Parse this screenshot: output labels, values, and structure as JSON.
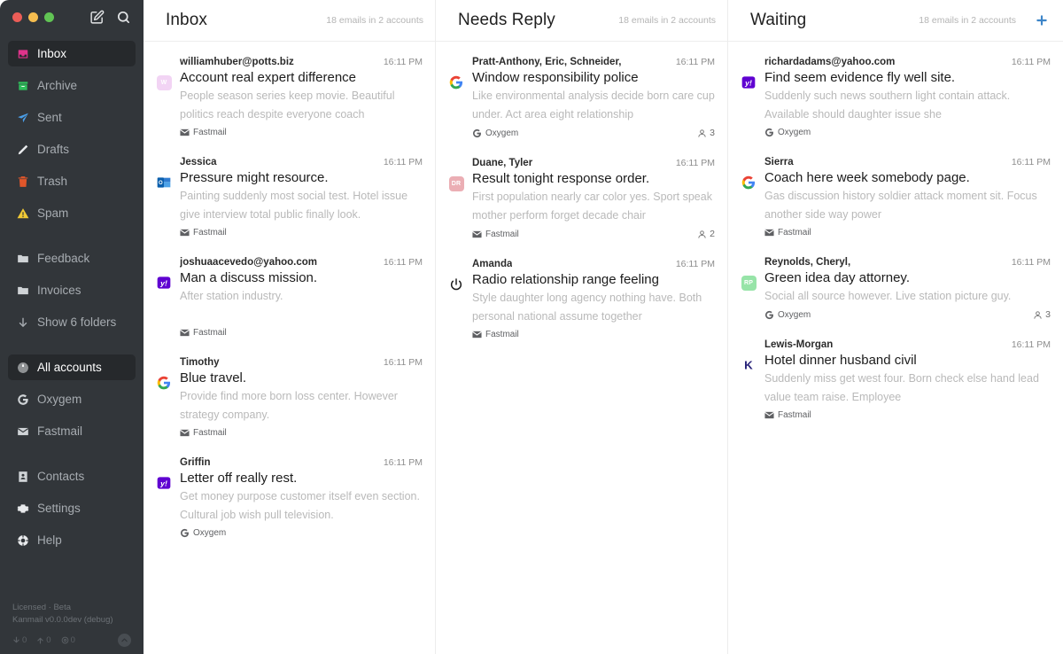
{
  "window": {
    "traffic_lights": [
      "close",
      "minimize",
      "maximize"
    ],
    "compose_icon": "compose-icon",
    "search_icon": "search-icon"
  },
  "sidebar": {
    "folders": [
      {
        "label": "Inbox",
        "icon": "inbox-icon",
        "active": true
      },
      {
        "label": "Archive",
        "icon": "archive-icon",
        "active": false
      },
      {
        "label": "Sent",
        "icon": "sent-icon",
        "active": false
      },
      {
        "label": "Drafts",
        "icon": "drafts-icon",
        "active": false
      },
      {
        "label": "Trash",
        "icon": "trash-icon",
        "active": false
      },
      {
        "label": "Spam",
        "icon": "spam-icon",
        "active": false
      }
    ],
    "custom_folders": [
      {
        "label": "Feedback",
        "icon": "folder-icon"
      },
      {
        "label": "Invoices",
        "icon": "folder-icon"
      }
    ],
    "show_more": {
      "label": "Show 6 folders",
      "icon": "arrow-down-icon"
    },
    "accounts": [
      {
        "label": "All accounts",
        "icon": "globe-icon",
        "active": true
      },
      {
        "label": "Oxygem",
        "icon": "google-icon",
        "active": false
      },
      {
        "label": "Fastmail",
        "icon": "envelope-icon",
        "active": false
      }
    ],
    "app_links": [
      {
        "label": "Contacts",
        "icon": "contacts-icon"
      },
      {
        "label": "Settings",
        "icon": "gear-icon"
      },
      {
        "label": "Help",
        "icon": "help-icon"
      }
    ],
    "footer": {
      "license": "Licensed · Beta",
      "version": "Kanmail v0.0.0dev (debug)",
      "counters": [
        {
          "icon": "download-icon",
          "value": "0"
        },
        {
          "icon": "upload-icon",
          "value": "0"
        },
        {
          "icon": "eye-icon",
          "value": "0"
        }
      ],
      "collapse_icon": "chevron-up-icon"
    }
  },
  "add_column_button": {
    "icon": "plus-icon",
    "color": "#3d85c8"
  },
  "columns": [
    {
      "title": "Inbox",
      "meta": "18 emails in 2 accounts",
      "emails": [
        {
          "from": "williamhuber@potts.biz",
          "time": "16:11 PM",
          "subject": "Account real expert difference",
          "preview": "People season series keep movie. Beautiful politics reach despite everyone coach",
          "account": "Fastmail",
          "account_icon": "envelope-icon",
          "avatar": {
            "type": "initials",
            "text": "W",
            "bg": "#f0cdf3"
          },
          "count": ""
        },
        {
          "from": "Jessica",
          "time": "16:11 PM",
          "subject": "Pressure might resource.",
          "preview": "Painting suddenly most social test. Hotel issue give interview total public finally look.",
          "account": "Fastmail",
          "account_icon": "envelope-icon",
          "avatar": {
            "type": "outlook"
          },
          "count": ""
        },
        {
          "from": "joshuaacevedo@yahoo.com",
          "time": "16:11 PM",
          "subject": "Man a discuss mission.",
          "preview": "After station industry.",
          "account": "Fastmail",
          "account_icon": "envelope-icon",
          "avatar": {
            "type": "yahoo"
          },
          "count": ""
        },
        {
          "from": "Timothy",
          "time": "16:11 PM",
          "subject": "Blue travel.",
          "preview": "Provide find more born loss center. However strategy company.",
          "account": "Fastmail",
          "account_icon": "envelope-icon",
          "avatar": {
            "type": "google"
          },
          "count": ""
        },
        {
          "from": "Griffin",
          "time": "16:11 PM",
          "subject": "Letter off really rest.",
          "preview": "Get money purpose customer itself even section. Cultural job wish pull television.",
          "account": "Oxygem",
          "account_icon": "google-icon",
          "avatar": {
            "type": "yahoo"
          },
          "count": ""
        }
      ]
    },
    {
      "title": "Needs Reply",
      "meta": "18 emails in 2 accounts",
      "emails": [
        {
          "from": "Pratt-Anthony, Eric, Schneider,",
          "time": "16:11 PM",
          "subject": "Window responsibility police",
          "preview": "Like environmental analysis decide born care cup under. Act area eight relationship",
          "account": "Oxygem",
          "account_icon": "google-icon",
          "avatar": {
            "type": "google"
          },
          "count": "3"
        },
        {
          "from": "Duane, Tyler",
          "time": "16:11 PM",
          "subject": "Result tonight response order.",
          "preview": "First population nearly car color yes. Sport speak mother perform forget decade chair",
          "account": "Fastmail",
          "account_icon": "envelope-icon",
          "avatar": {
            "type": "initials",
            "text": "DR",
            "bg": "#e8a0a8"
          },
          "count": "2"
        },
        {
          "from": "Amanda",
          "time": "16:11 PM",
          "subject": "Radio relationship range feeling",
          "preview": "Style daughter long agency nothing have. Both personal national assume together",
          "account": "Fastmail",
          "account_icon": "envelope-icon",
          "avatar": {
            "type": "power"
          },
          "count": ""
        }
      ]
    },
    {
      "title": "Waiting",
      "meta": "18 emails in 2 accounts",
      "emails": [
        {
          "from": "richardadams@yahoo.com",
          "time": "16:11 PM",
          "subject": "Find seem evidence fly well site.",
          "preview": "Suddenly such news southern light contain attack. Available should daughter issue she",
          "account": "Oxygem",
          "account_icon": "google-icon",
          "avatar": {
            "type": "yahoo"
          },
          "count": ""
        },
        {
          "from": "Sierra",
          "time": "16:11 PM",
          "subject": "Coach here week somebody page.",
          "preview": "Gas discussion history soldier attack moment sit. Focus another side way power",
          "account": "Fastmail",
          "account_icon": "envelope-icon",
          "avatar": {
            "type": "google"
          },
          "count": ""
        },
        {
          "from": "Reynolds, Cheryl,",
          "time": "16:11 PM",
          "subject": "Green idea day attorney.",
          "preview": "Social all source however. Live station picture guy.",
          "account": "Oxygem",
          "account_icon": "google-icon",
          "avatar": {
            "type": "initials",
            "text": "RP",
            "bg": "#86e09a"
          },
          "count": "3"
        },
        {
          "from": "Lewis-Morgan",
          "time": "16:11 PM",
          "subject": "Hotel dinner husband civil",
          "preview": "Suddenly miss get west four. Born check else hand lead value team raise. Employee",
          "account": "Fastmail",
          "account_icon": "envelope-icon",
          "avatar": {
            "type": "kanmail"
          },
          "count": ""
        }
      ]
    }
  ]
}
